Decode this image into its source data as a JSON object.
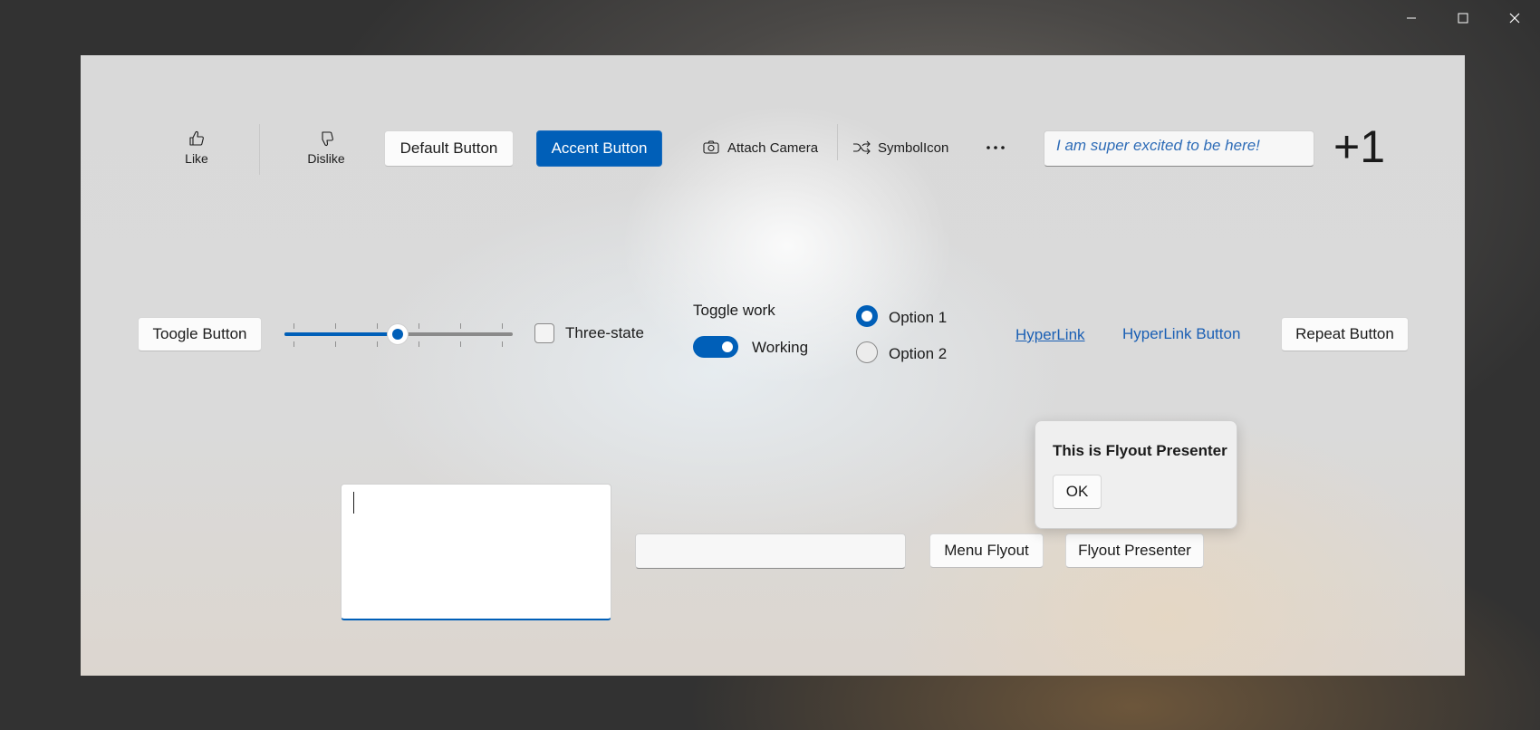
{
  "window": {
    "caption_buttons": {
      "minimize": "minimize-icon",
      "maximize": "maximize-icon",
      "close": "close-icon"
    }
  },
  "appbar": {
    "like_label": "Like",
    "dislike_label": "Dislike",
    "default_button": "Default Button",
    "accent_button": "Accent Button",
    "attach_camera": "Attach Camera",
    "symbol_icon": "SymbolIcon",
    "more": "more-icon",
    "textbox_value": "I am super excited to be here!",
    "plus_one": "+1"
  },
  "controls": {
    "toggle_button": "Toogle Button",
    "slider_value_fraction": 0.5,
    "three_state_label": "Three-state",
    "toggle_switch_header": "Toggle work",
    "toggle_switch_state": "Working",
    "toggle_switch_on": true,
    "radio_option1": "Option 1",
    "radio_option2": "Option 2",
    "radio_selected": "Option 1",
    "hyperlink": "HyperLink",
    "hyperlink_button": "HyperLink Button",
    "repeat_button": "Repeat Button"
  },
  "bottom": {
    "rich_editor_value": "",
    "single_textbox_value": "",
    "menu_flyout": "Menu Flyout",
    "flyout_presenter_button": "Flyout Presenter"
  },
  "flyout": {
    "title": "This is Flyout Presenter",
    "ok_button": "OK"
  },
  "colors": {
    "accent": "#005fb8",
    "link": "#1a5fb4"
  }
}
